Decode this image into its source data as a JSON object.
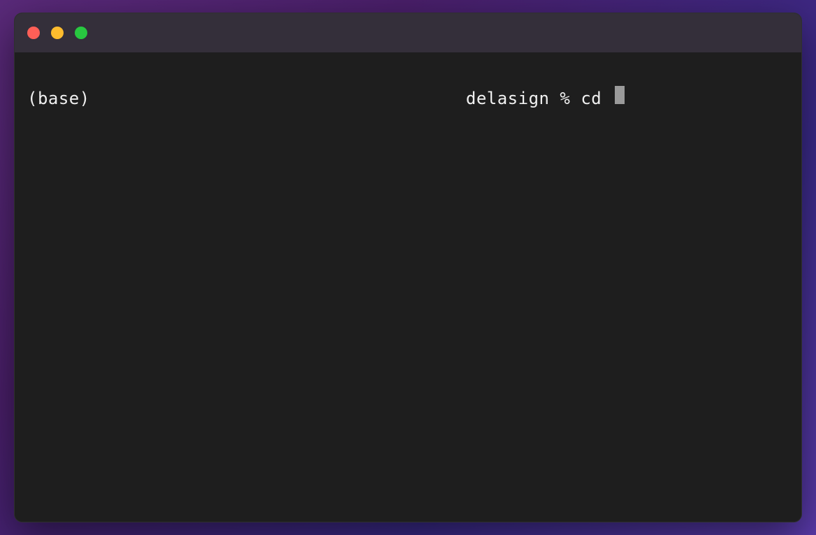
{
  "window": {
    "traffic_lights": {
      "close": "close",
      "minimize": "minimize",
      "maximize": "maximize"
    }
  },
  "terminal": {
    "prompt": {
      "env": "(base)",
      "spacer": "                                    ",
      "user": "delasign",
      "symbol": " % ",
      "command": "cd "
    }
  }
}
